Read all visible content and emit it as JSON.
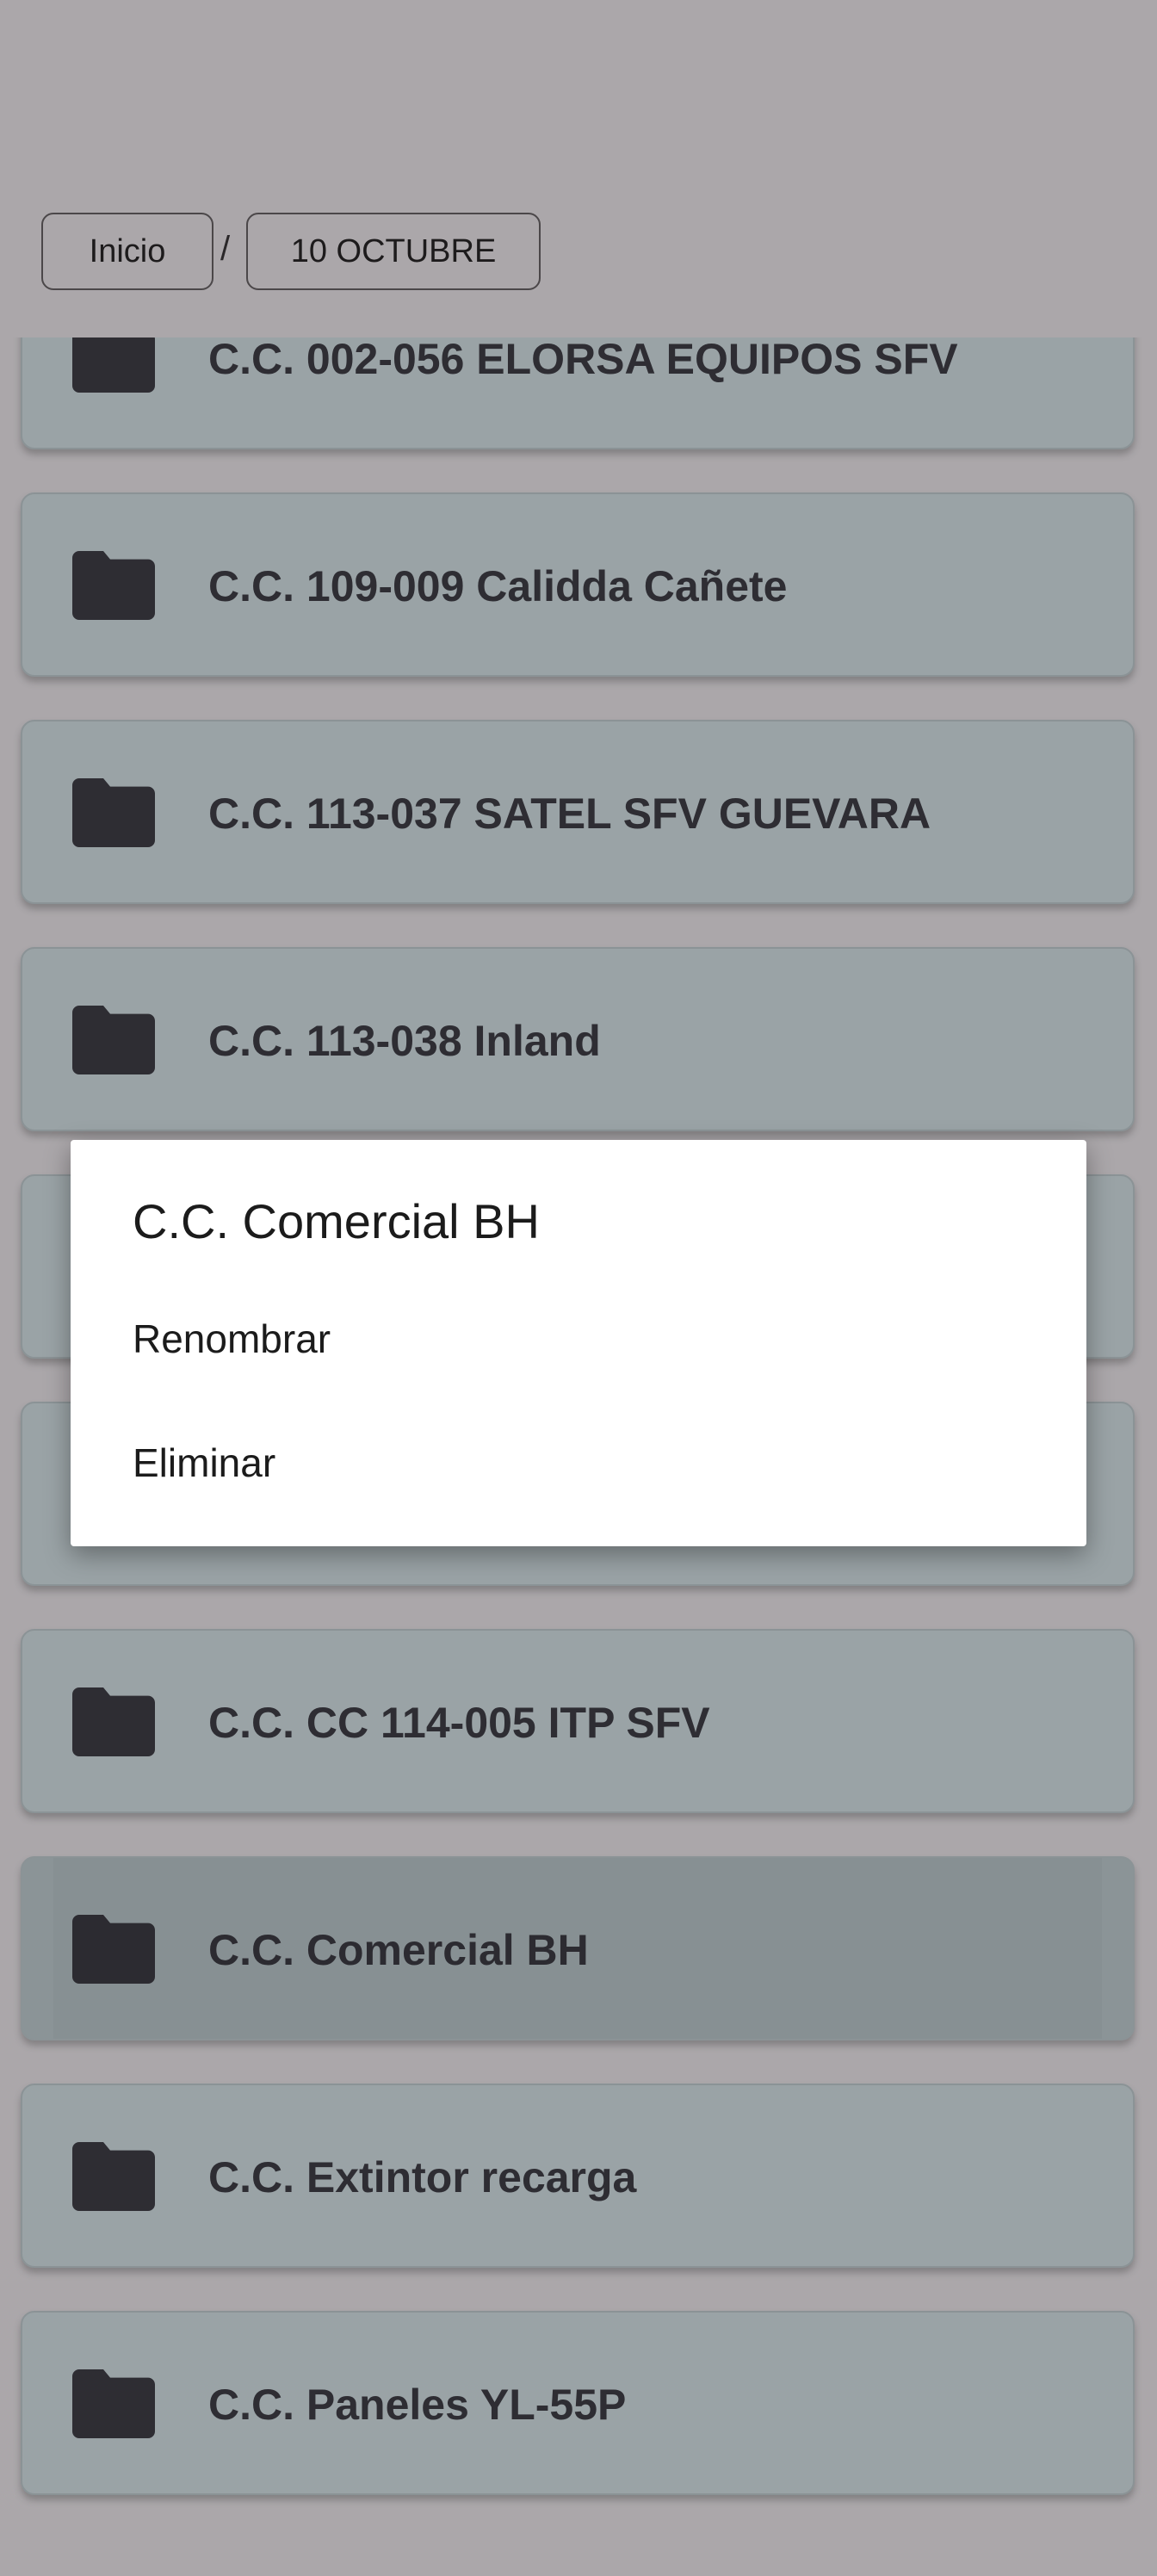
{
  "breadcrumb": {
    "home": "Inicio",
    "separator": "/",
    "current": "10 OCTUBRE"
  },
  "folders": [
    {
      "name": "C.C. 002-056 ELORSA EQUIPOS SFV"
    },
    {
      "name": "C.C. 109-009 Calidda Cañete"
    },
    {
      "name": "C.C. 113-037 SATEL SFV GUEVARA"
    },
    {
      "name": "C.C. 113-038 Inland"
    },
    {
      "name": ""
    },
    {
      "name": ""
    },
    {
      "name": "C.C. CC 114-005 ITP SFV"
    },
    {
      "name": "C.C. Comercial BH",
      "selected": true
    },
    {
      "name": "C.C. Extintor recarga"
    },
    {
      "name": "C.C. Paneles YL-55P"
    }
  ],
  "dialog": {
    "title": "C.C. Comercial BH",
    "options": [
      "Renombrar",
      "Eliminar"
    ]
  },
  "icons": {
    "folder": "folder-icon"
  },
  "colors": {
    "background": "#aba7aa",
    "card": "#9aa3a6",
    "card_selected": "#8b9497",
    "folder_icon": "#2e2d33",
    "dialog": "#ffffff"
  }
}
